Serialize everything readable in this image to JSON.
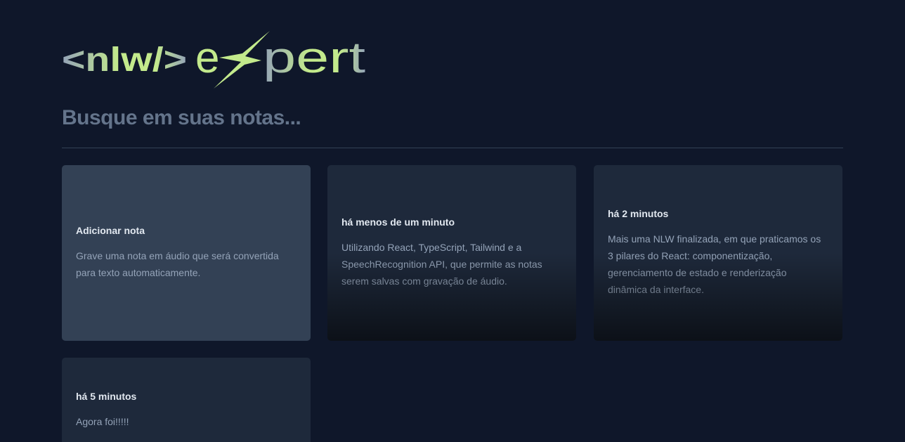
{
  "logo": {
    "tag_text": "<nlw/>",
    "word_left": "e",
    "word_right": "pert"
  },
  "search": {
    "placeholder": "Busque em suas notas..."
  },
  "add_note_card": {
    "title": "Adicionar nota",
    "description": "Grave uma nota em áudio que será convertida para texto automaticamente."
  },
  "notes": [
    {
      "date": "há menos de um minuto",
      "content": "Utilizando React, TypeScript, Tailwind e a SpeechRecognition API, que permite as notas serem salvas com gravação de áudio."
    },
    {
      "date": "há 2 minutos",
      "content": "Mais uma NLW finalizada, em que praticamos os 3 pilares do React: componentização, gerenciamento de estado e renderização dinâmica da interface."
    },
    {
      "date": "há 5 minutos",
      "content": "Agora foi!!!!!"
    }
  ],
  "colors": {
    "background": "#0f172a",
    "card_add": "#334155",
    "card_note": "#1e293b",
    "logo_green": "#c3ea8c",
    "logo_gray": "#94a3b8"
  }
}
